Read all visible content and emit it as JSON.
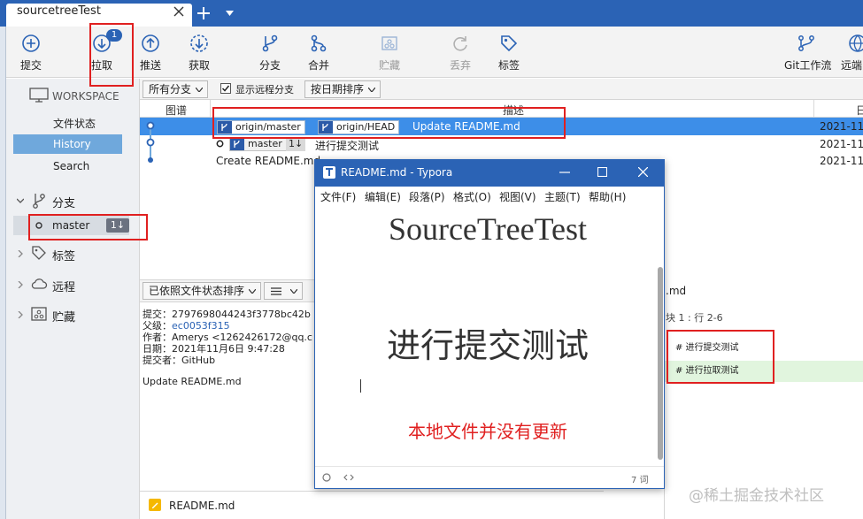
{
  "window": {
    "tab_title": "sourcetreeTest"
  },
  "toolbar": {
    "commit": "提交",
    "pull": "拉取",
    "pull_badge": "1",
    "push": "推送",
    "fetch": "获取",
    "branch": "分支",
    "merge": "合并",
    "stash": "贮藏",
    "discard": "丢弃",
    "tag": "标签",
    "git_flow": "Git工作流",
    "remote": "远端"
  },
  "sidebar": {
    "workspace": "WORKSPACE",
    "file_status": "文件状态",
    "history": "History",
    "search": "Search",
    "branches": "分支",
    "master": "master",
    "master_badge": "1↓",
    "tags": "标签",
    "remotes": "远程",
    "stashes": "贮藏"
  },
  "filters": {
    "branches_combo": "所有分支",
    "show_remote_label": "显示远程分支",
    "show_remote_checked": true,
    "sort_combo": "按日期排序"
  },
  "columns": {
    "graph": "图谱",
    "description": "描述",
    "date": "日"
  },
  "commits": [
    {
      "refs": [
        "origin/master",
        "origin/HEAD"
      ],
      "message": "Update README.md",
      "date": "2021-11"
    },
    {
      "refs": [
        "master"
      ],
      "ahead_behind": "1↓",
      "message": "进行提交测试",
      "date": "2021-11"
    },
    {
      "refs": [],
      "message": "Create README.md",
      "date": "2021-11"
    }
  ],
  "lower": {
    "sort_combo": "已依照文件状态排序",
    "file_fragment": ".md",
    "hunk_label": "块 1 : 行 2-6"
  },
  "details": {
    "commit_label": "提交：",
    "commit_value": "2797698044243f3778bc42b",
    "parent_label": "父级：",
    "parent_value": "ec0053f315",
    "author_label": "作者：",
    "author_value": "Amerys <1262426172@qq.c",
    "date_label": "日期：",
    "date_value": "2021年11月6日 9:47:28",
    "committer_label": "提交者：",
    "committer_value": "GitHub",
    "message": "Update README.md"
  },
  "files": [
    {
      "name": "README.md",
      "status_color": "#f5b800"
    }
  ],
  "diff": [
    {
      "text": "# 进行提交测试",
      "type": "context"
    },
    {
      "text": "# 进行拉取测试",
      "type": "added"
    }
  ],
  "typora": {
    "title": "README.md - Typora",
    "menus": [
      "文件(F)",
      "编辑(E)",
      "段落(P)",
      "格式(O)",
      "视图(V)",
      "主题(T)",
      "帮助(H)"
    ],
    "heading1": "SourceTreeTest",
    "heading2": "进行提交测试",
    "note": "本地文件并没有更新",
    "word_count": "7 词"
  },
  "watermark": "@稀土掘金技术社区",
  "colors": {
    "accent": "#2b63b5",
    "selection": "#3d8ee8",
    "highlight": "#e02020"
  }
}
